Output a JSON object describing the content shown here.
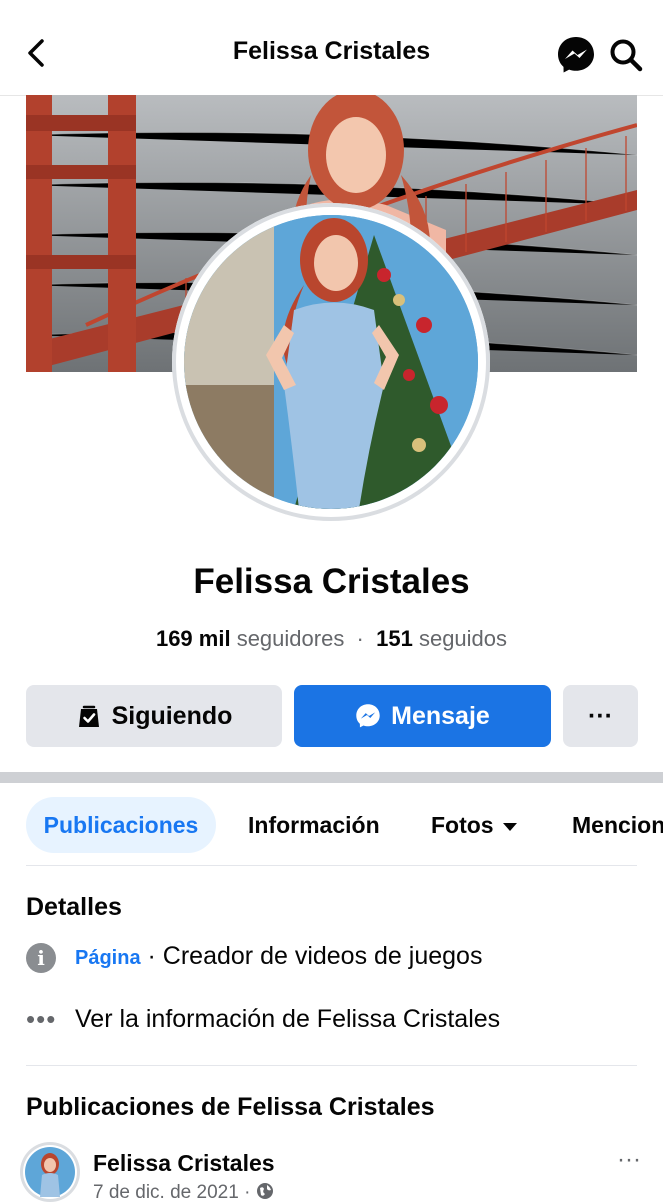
{
  "header": {
    "title": "Felissa Cristales",
    "back_icon": "chevron-left-icon",
    "messenger_icon": "messenger-icon",
    "search_icon": "search-icon"
  },
  "profile": {
    "name": "Felissa Cristales",
    "followers_count": "169 mil",
    "followers_label": "seguidores",
    "following_count": "151",
    "following_label": "seguidos"
  },
  "actions": {
    "following_label": "Siguiendo",
    "message_label": "Mensaje",
    "more_label": "···"
  },
  "tabs": [
    {
      "label": "Publicaciones",
      "active": true
    },
    {
      "label": "Información"
    },
    {
      "label": "Fotos"
    },
    {
      "label": "Mencion"
    }
  ],
  "details": {
    "heading": "Detalles",
    "page_label": "Página",
    "category": "· Creador de videos de juegos",
    "see_info": "Ver la información de Felissa Cristales"
  },
  "posts": {
    "heading": "Publicaciones de Felissa Cristales",
    "author": "Felissa Cristales",
    "date": "7 de dic. de 2021 ·",
    "more_label": "···"
  },
  "colors": {
    "accent": "#1b74e4",
    "tab_active_bg": "#e7f3ff",
    "button_gray": "#e4e6eb"
  }
}
